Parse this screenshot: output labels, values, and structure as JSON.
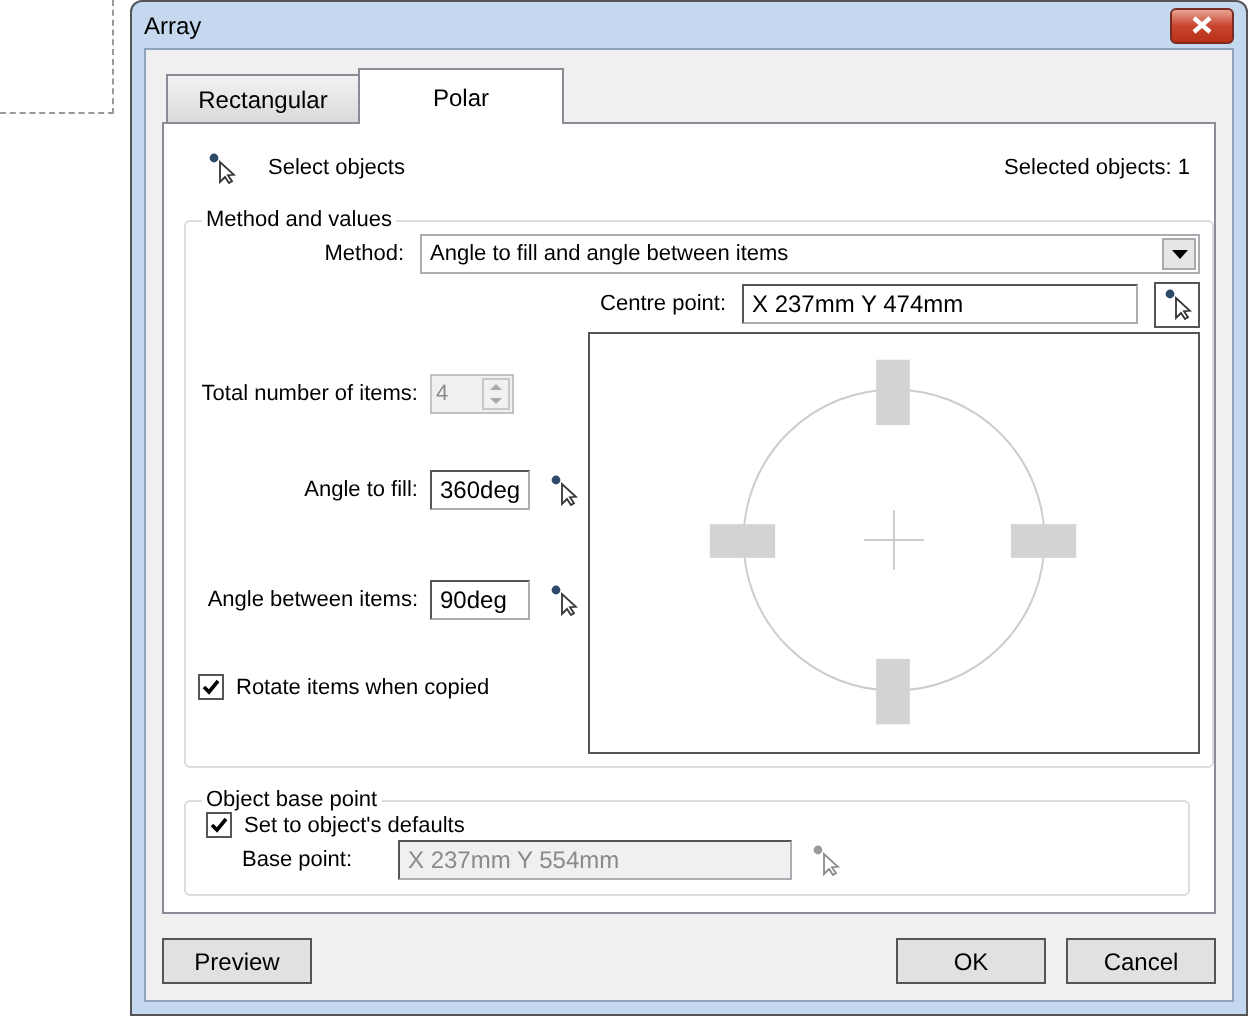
{
  "window": {
    "title": "Array"
  },
  "tabs": [
    {
      "label": "Rectangular",
      "selected": false
    },
    {
      "label": "Polar",
      "selected": true
    }
  ],
  "select_objects": {
    "label": "Select objects",
    "count": "Selected objects: 1"
  },
  "method_group": {
    "title": "Method and values",
    "method": {
      "label": "Method:",
      "value": "Angle to fill and angle between items"
    },
    "centre_point": {
      "label": "Centre point:",
      "value": "X 237mm Y 474mm"
    },
    "fields": [
      {
        "kind": "spin",
        "label": "Total number of items:",
        "value": "4",
        "disabled": true
      },
      {
        "kind": "pick",
        "label": "Angle to fill:",
        "value": "360deg",
        "disabled": false
      },
      {
        "kind": "pick",
        "label": "Angle between items:",
        "value": "90deg",
        "disabled": false
      }
    ],
    "rotate": {
      "label": "Rotate items when copied",
      "checked": true
    }
  },
  "base_group": {
    "title": "Object base point",
    "defaults": {
      "label": "Set to object's defaults",
      "checked": true
    },
    "base_point": {
      "label": "Base point:",
      "value": "X 237mm Y 554mm",
      "disabled": true
    }
  },
  "buttons": {
    "left": [
      "Preview"
    ],
    "right": [
      "OK",
      "Cancel"
    ]
  }
}
